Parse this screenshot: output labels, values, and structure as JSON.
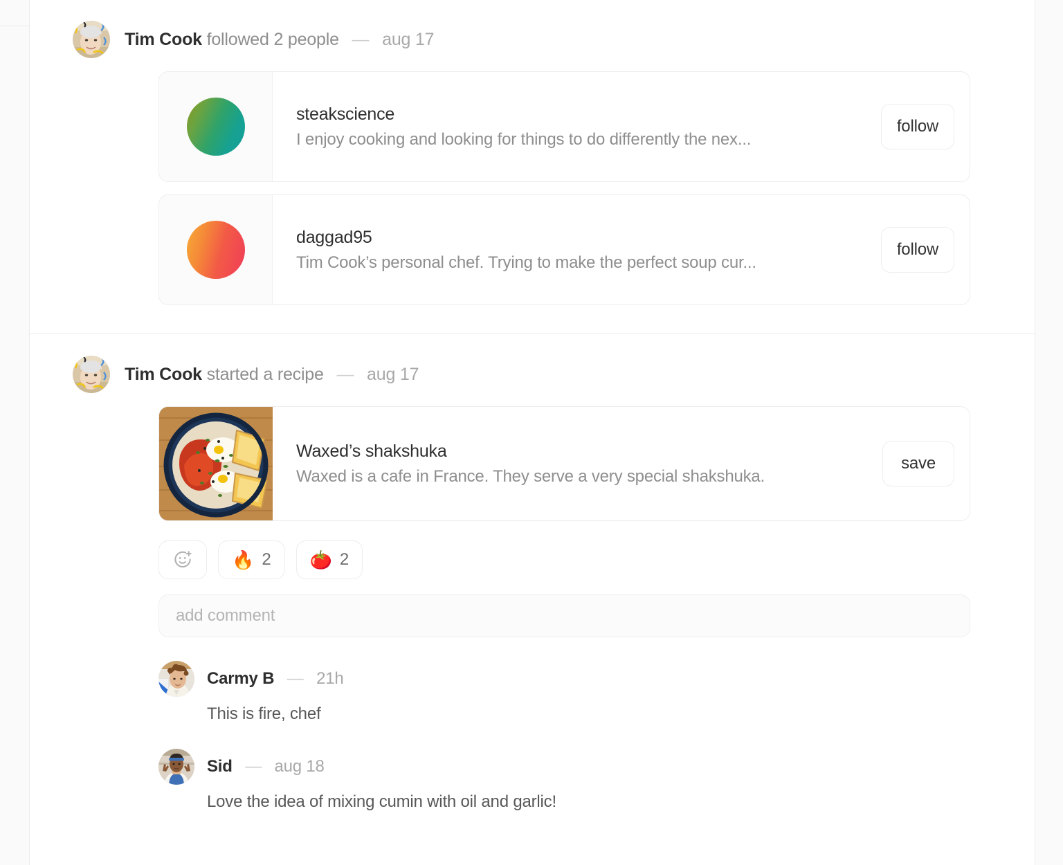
{
  "posts": [
    {
      "id": "follow-post",
      "author": "Tim Cook",
      "action": "followed 2 people",
      "dash": "—",
      "date": "aug 17",
      "avatar_name": "tim-cook-avatar",
      "cards": [
        {
          "title": "steakscience",
          "desc": "I enjoy cooking and looking for things to do differently the nex...",
          "button": "follow",
          "avatar_type": "gradient",
          "gradient_from": "#8a9a22",
          "gradient_mid": "#2fa36a",
          "gradient_to": "#13a0a0"
        },
        {
          "title": "daggad95",
          "desc": "Tim Cook’s personal chef. Trying to make the perfect soup cur...",
          "button": "follow",
          "avatar_type": "gradient",
          "gradient_from": "#f5a33a",
          "gradient_mid": "#f2643f",
          "gradient_to": "#f03c5a"
        }
      ]
    },
    {
      "id": "recipe-post",
      "author": "Tim Cook",
      "action": "started a recipe",
      "dash": "—",
      "date": "aug 17",
      "avatar_name": "tim-cook-avatar",
      "recipe": {
        "title": "Waxed’s shakshuka",
        "desc": "Waxed is a cafe in France. They serve a very special shakshuka.",
        "button": "save",
        "thumbnail_alt": "shakshuka-photo"
      },
      "reactions": [
        {
          "icon": "add-reaction-icon",
          "emoji": "",
          "count": ""
        },
        {
          "icon": "fire-emoji",
          "emoji": "🔥",
          "count": "2"
        },
        {
          "icon": "tomato-emoji",
          "emoji": "🍅",
          "count": "2"
        }
      ],
      "comment_box": {
        "placeholder": "add comment"
      },
      "comments": [
        {
          "author": "Carmy B",
          "dash": "—",
          "time": "21h",
          "text": "This is fire, chef",
          "avatar_name": "carmy-avatar"
        },
        {
          "author": "Sid",
          "dash": "—",
          "time": "aug 18",
          "text": "Love the idea of mixing cumin with oil and garlic!",
          "avatar_name": "sid-avatar"
        }
      ]
    }
  ],
  "colors": {
    "text_primary": "#2e2e2e",
    "text_secondary": "#8e8e8e",
    "text_muted": "#a8a8a8",
    "border": "#ededed",
    "rail_bg": "#fafafa"
  }
}
